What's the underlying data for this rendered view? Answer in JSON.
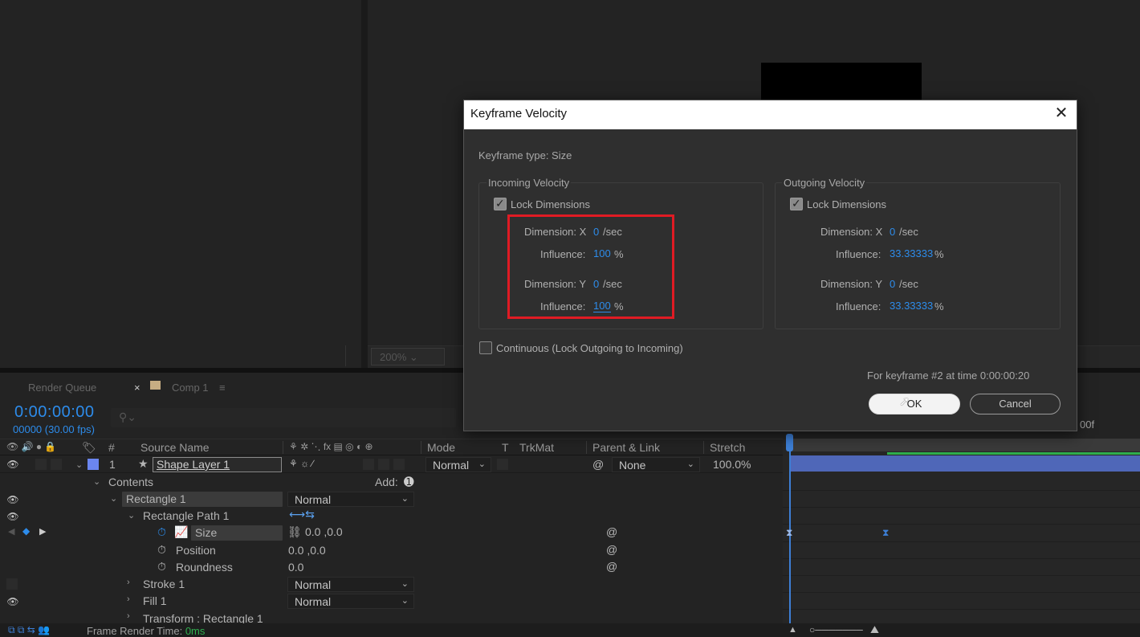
{
  "viewer": {
    "zoom": "200%"
  },
  "tabs": {
    "render_queue": "Render Queue",
    "comp": "Comp 1",
    "close": "×",
    "menu": "≡"
  },
  "timeline": {
    "timecode": "0:00:00:00",
    "fps": "00000 (30.00 fps)",
    "search_icon": "search-icon",
    "ruler_label": "00f",
    "headers": {
      "number": "#",
      "source_name": "Source Name",
      "mode": "Mode",
      "t": "T",
      "trkmat": "TrkMat",
      "parent_link": "Parent & Link",
      "stretch": "Stretch"
    },
    "layer": {
      "index": "1",
      "name": "Shape Layer 1",
      "mode": "Normal",
      "parent": "None",
      "stretch": "100.0%"
    },
    "rows": {
      "contents": "Contents",
      "add": "Add:",
      "rectangle": "Rectangle 1",
      "rectangle_mode": "Normal",
      "rectangle_path": "Rectangle Path 1",
      "size": "Size",
      "size_value": "0.0 ,0.0",
      "position": "Position",
      "position_value": "0.0 ,0.0",
      "roundness": "Roundness",
      "roundness_value": "0.0",
      "stroke": "Stroke 1",
      "stroke_mode": "Normal",
      "fill": "Fill 1",
      "fill_mode": "Normal",
      "transform": "Transform : Rectangle 1"
    },
    "status": {
      "label": "Frame Render Time:",
      "value": "0ms"
    }
  },
  "dialog": {
    "title": "Keyframe Velocity",
    "keyframe_type": "Keyframe type: Size",
    "incoming": {
      "legend": "Incoming Velocity",
      "lock": "Lock Dimensions",
      "dim_x_label": "Dimension: X",
      "dim_x_value": "0",
      "dim_x_unit": "/sec",
      "inf_x_label": "Influence:",
      "inf_x_value": "100",
      "inf_unit": "%",
      "dim_y_label": "Dimension: Y",
      "dim_y_value": "0",
      "dim_y_unit": "/sec",
      "inf_y_label": "Influence:",
      "inf_y_value": "100"
    },
    "outgoing": {
      "legend": "Outgoing Velocity",
      "lock": "Lock Dimensions",
      "dim_x_label": "Dimension: X",
      "dim_x_value": "0",
      "dim_x_unit": "/sec",
      "inf_x_label": "Influence:",
      "inf_x_value": "33.33333",
      "inf_unit": "%",
      "dim_y_label": "Dimension: Y",
      "dim_y_value": "0",
      "dim_y_unit": "/sec",
      "inf_y_label": "Influence:",
      "inf_y_value": "33.33333"
    },
    "continuous": "Continuous (Lock Outgoing to Incoming)",
    "kf_info": "For keyframe #2 at time 0:00:00:20",
    "ok": "OK",
    "cancel": "Cancel"
  },
  "colors": {
    "accent_blue": "#2d8ceb",
    "highlight_red": "#e01b24",
    "layer_bar": "#4f67b8",
    "label_tan": "#c7ad83"
  }
}
